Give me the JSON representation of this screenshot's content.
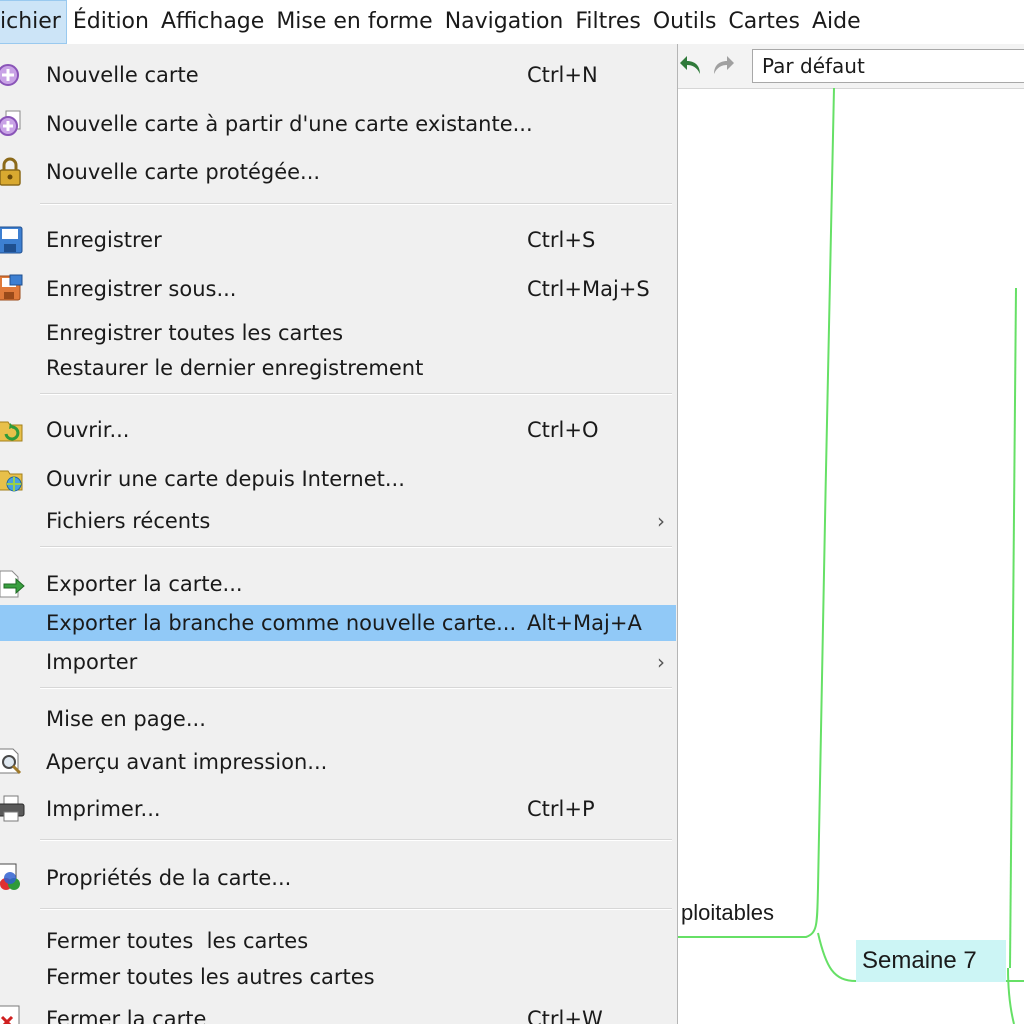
{
  "menubar": {
    "items": [
      "ichier",
      "Édition",
      "Affichage",
      "Mise en forme",
      "Navigation",
      "Filtres",
      "Outils",
      "Cartes",
      "Aide"
    ]
  },
  "toolbar": {
    "undo_icon": "undo-arrow-icon",
    "redo_icon": "redo-arrow-icon",
    "style_select_value": "Par défaut"
  },
  "file_menu": {
    "items": [
      {
        "label": "Nouvelle carte",
        "shortcut": "Ctrl+N",
        "icon": "new-map-icon"
      },
      {
        "label": "Nouvelle carte à partir d'une carte existante...",
        "shortcut": "",
        "icon": "new-map-from-existing-icon"
      },
      {
        "label": "Nouvelle carte protégée...",
        "shortcut": "",
        "icon": "lock-icon"
      },
      {
        "label": "Enregistrer",
        "shortcut": "Ctrl+S",
        "icon": "save-icon"
      },
      {
        "label": "Enregistrer sous...",
        "shortcut": "Ctrl+Maj+S",
        "icon": "save-as-icon"
      },
      {
        "label": "Enregistrer toutes les cartes",
        "shortcut": "",
        "icon": ""
      },
      {
        "label": "Restaurer le dernier enregistrement",
        "shortcut": "",
        "icon": ""
      },
      {
        "label": "Ouvrir...",
        "shortcut": "Ctrl+O",
        "icon": "open-folder-icon"
      },
      {
        "label": "Ouvrir une carte depuis Internet...",
        "shortcut": "",
        "icon": "open-internet-icon"
      },
      {
        "label": "Fichiers récents",
        "shortcut": "",
        "icon": "",
        "submenu": true
      },
      {
        "label": "Exporter la carte...",
        "shortcut": "",
        "icon": "export-icon"
      },
      {
        "label": "Exporter la branche comme nouvelle carte...",
        "shortcut": "Alt+Maj+A",
        "icon": "",
        "highlighted": true
      },
      {
        "label": "Importer",
        "shortcut": "",
        "icon": "",
        "submenu": true
      },
      {
        "label": "Mise en page...",
        "shortcut": "",
        "icon": ""
      },
      {
        "label": "Aperçu avant impression...",
        "shortcut": "",
        "icon": "print-preview-icon"
      },
      {
        "label": "Imprimer...",
        "shortcut": "Ctrl+P",
        "icon": "printer-icon"
      },
      {
        "label": "Propriétés de la carte...",
        "shortcut": "",
        "icon": "map-properties-icon"
      },
      {
        "label": "Fermer toutes  les cartes",
        "shortcut": "",
        "icon": ""
      },
      {
        "label": "Fermer toutes les autres cartes",
        "shortcut": "",
        "icon": ""
      },
      {
        "label": "Fermer la carte",
        "shortcut": "Ctrl+W",
        "icon": "close-map-icon"
      }
    ],
    "submenu_arrow": "›"
  },
  "mindmap": {
    "node_left": "ploitables",
    "node_semaine": "Semaine 7",
    "edge_color": "#66e066",
    "node_bg": "#ccf5f5"
  }
}
